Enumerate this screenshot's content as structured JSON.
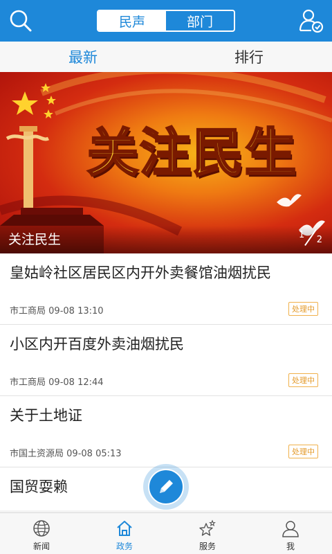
{
  "header": {
    "segments": [
      {
        "label": "民声",
        "active": true
      },
      {
        "label": "部门",
        "active": false
      }
    ]
  },
  "subtabs": [
    {
      "label": "最新",
      "active": true
    },
    {
      "label": "排行",
      "active": false
    }
  ],
  "banner": {
    "hero_text": "关注民生",
    "caption": "关注民生",
    "page_current": "1",
    "page_total": "2"
  },
  "list": [
    {
      "title": "皇姑岭社区居民区内开外卖餐馆油烟扰民",
      "department": "市工商局",
      "time": "09-08 13:10",
      "status": "处理中"
    },
    {
      "title": "小区内开百度外卖油烟扰民",
      "department": "市工商局",
      "time": "09-08 12:44",
      "status": "处理中"
    },
    {
      "title": "关于土地证",
      "department": "市国土资源局",
      "time": "09-08 05:13",
      "status": "处理中"
    },
    {
      "title": "国贸耍赖"
    }
  ],
  "bottomnav": [
    {
      "label": "新闻",
      "icon": "globe-icon",
      "active": false
    },
    {
      "label": "政务",
      "icon": "house-icon",
      "active": true
    },
    {
      "label": "服务",
      "icon": "stars-icon",
      "active": false
    },
    {
      "label": "我",
      "icon": "person-icon",
      "active": false
    }
  ],
  "colors": {
    "brand": "#1e88d9",
    "status": "#e49a2a",
    "banner_red": "#d42c10",
    "banner_gold": "#ffd22e"
  }
}
